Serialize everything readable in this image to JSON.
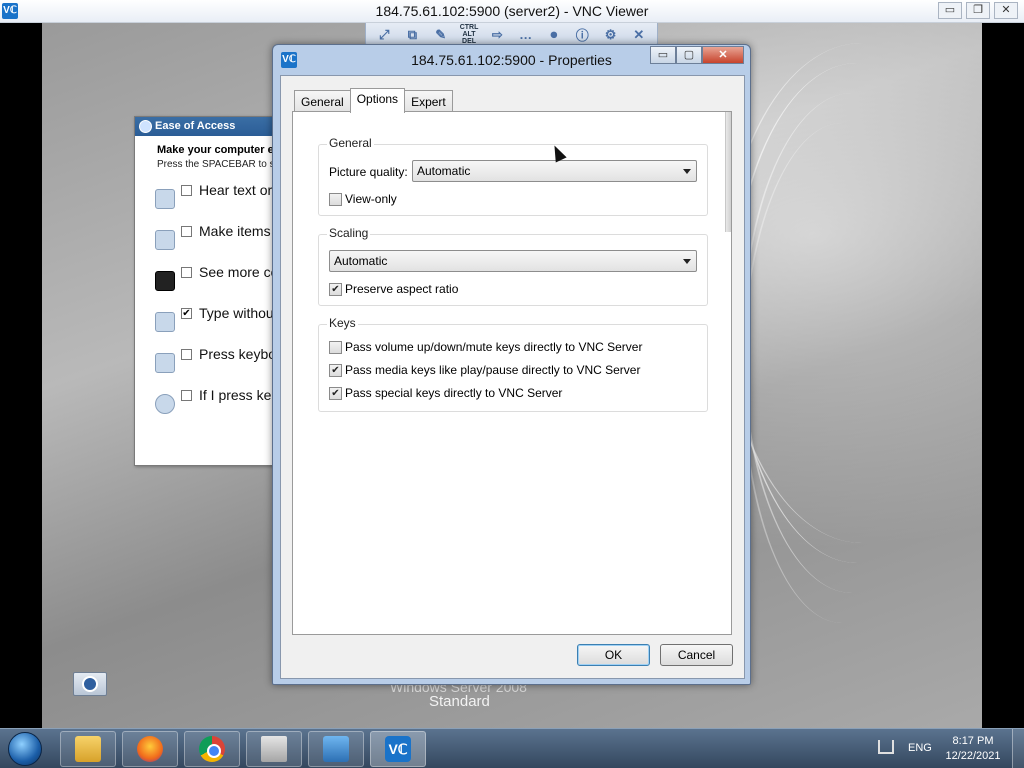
{
  "vnc_window": {
    "app_icon": "Vℂ",
    "title": "184.75.61.102:5900 (server2) - VNC Viewer",
    "buttons": {
      "minimize": "▭",
      "restore": "❐",
      "close": "✕"
    },
    "toolbar": {
      "items": [
        {
          "icon": "fullscreen-icon",
          "glyph": "⤢"
        },
        {
          "icon": "scale-icon",
          "glyph": "⧉"
        },
        {
          "icon": "annotate-icon",
          "glyph": "✎"
        },
        {
          "icon": "ctrl-alt-del-icon",
          "glyph": "CTRL ALT DEL"
        },
        {
          "icon": "transfer-icon",
          "glyph": "⇨"
        },
        {
          "icon": "chat-icon",
          "glyph": "…"
        },
        {
          "icon": "record-icon",
          "glyph": "⏺"
        },
        {
          "icon": "info-icon",
          "glyph": "ⓘ"
        },
        {
          "icon": "settings-icon",
          "glyph": "⚙"
        },
        {
          "icon": "close-icon",
          "glyph": "✕"
        }
      ]
    }
  },
  "ease_of_access": {
    "title": "Ease of Access",
    "heading": "Make your computer e",
    "subtitle": "Press the SPACEBAR to se",
    "options": [
      {
        "label": "Hear text or",
        "checked": false
      },
      {
        "label": "Make items",
        "checked": false
      },
      {
        "label": "See more co",
        "checked": false
      },
      {
        "label": "Type withou",
        "checked": true
      },
      {
        "label": "Press keybo",
        "checked": false
      },
      {
        "label": "If I press ke",
        "checked": false
      }
    ]
  },
  "dialog": {
    "icon": "Vℂ",
    "title": "184.75.61.102:5900 - Properties",
    "buttons": {
      "minimize": "▭",
      "restore": "▢",
      "close": "✕"
    },
    "tabs": [
      {
        "label": "General",
        "active": false
      },
      {
        "label": "Options",
        "active": true
      },
      {
        "label": "Expert",
        "active": false
      }
    ],
    "groups": {
      "general": {
        "title": "General",
        "picture_quality_label": "Picture quality:",
        "picture_quality_value": "Automatic",
        "view_only_label": "View-only",
        "view_only_checked": false
      },
      "scaling": {
        "title": "Scaling",
        "scaling_value": "Automatic",
        "preserve_label": "Preserve aspect ratio",
        "preserve_checked": true
      },
      "keys": {
        "title": "Keys",
        "items": [
          {
            "label": "Pass volume up/down/mute keys directly to VNC Server",
            "checked": false
          },
          {
            "label": "Pass media keys like play/pause directly to VNC Server",
            "checked": true
          },
          {
            "label": "Pass special keys directly to VNC Server",
            "checked": true
          }
        ]
      }
    },
    "ok_label": "OK",
    "cancel_label": "Cancel"
  },
  "desktop": {
    "brand_line": "Windows Server 2008",
    "edition": "Standard"
  },
  "taskbar": {
    "apps": [
      "file-explorer-icon",
      "firefox-icon",
      "chrome-icon",
      "media-icon",
      "server-manager-icon",
      "vnc-viewer-icon"
    ],
    "language": "ENG",
    "time": "8:17 PM",
    "date": "12/22/2021"
  }
}
